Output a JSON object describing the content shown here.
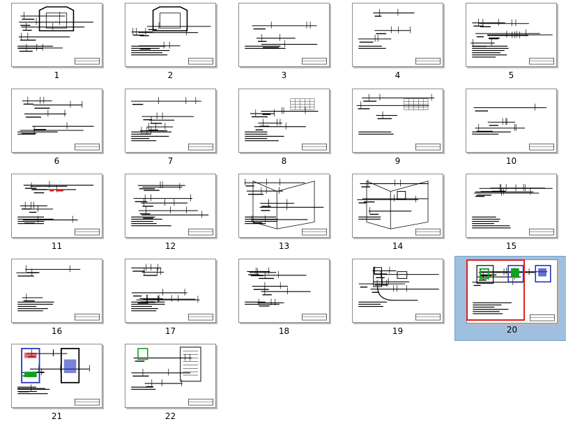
{
  "selected_page": "20",
  "thumbnails": [
    {
      "label": "1"
    },
    {
      "label": "2"
    },
    {
      "label": "3"
    },
    {
      "label": "4"
    },
    {
      "label": "5"
    },
    {
      "label": "6"
    },
    {
      "label": "7"
    },
    {
      "label": "8"
    },
    {
      "label": "9"
    },
    {
      "label": "10"
    },
    {
      "label": "11"
    },
    {
      "label": "12"
    },
    {
      "label": "13"
    },
    {
      "label": "14"
    },
    {
      "label": "15"
    },
    {
      "label": "16"
    },
    {
      "label": "17"
    },
    {
      "label": "18"
    },
    {
      "label": "19"
    },
    {
      "label": "20"
    },
    {
      "label": "21"
    },
    {
      "label": "22"
    }
  ],
  "colors": {
    "selection_fill": "#9fbfe0",
    "selection_outline": "#e02020",
    "drawing_ink": "#000000",
    "accent_red": "#d01010",
    "accent_blue": "#2030c0",
    "accent_green": "#10a020"
  }
}
